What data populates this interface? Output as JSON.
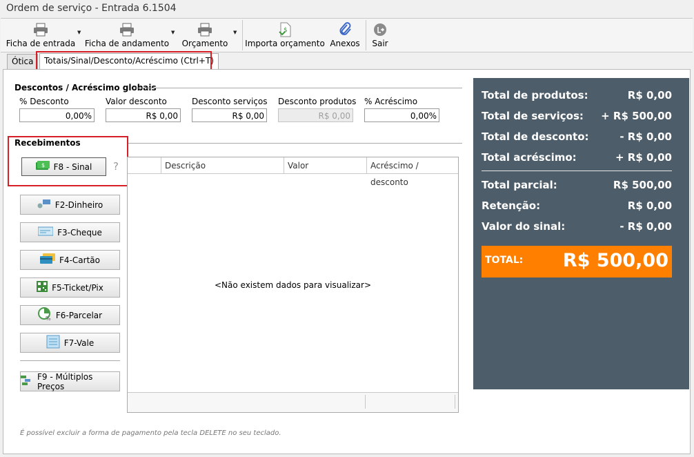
{
  "window": {
    "title": "Ordem de serviço - Entrada  6.1504"
  },
  "toolbar": {
    "ficha_entrada": "Ficha de entrada",
    "ficha_andamento": "Ficha de andamento",
    "orcamento": "Orçamento",
    "importa_orcamento": "Importa orçamento",
    "anexos": "Anexos",
    "sair": "Sair"
  },
  "tabs": {
    "otica": "Ótica",
    "totais": "Totais/Sinal/Desconto/Acréscimo (Ctrl+T)"
  },
  "descontos": {
    "title": "Descontos / Acréscimo globais",
    "pct_desconto_label": "% Desconto",
    "pct_desconto_value": "0,00%",
    "valor_desconto_label": "Valor desconto",
    "valor_desconto_value": "R$ 0,00",
    "desconto_servicos_label": "Desconto serviços",
    "desconto_servicos_value": "R$ 0,00",
    "desconto_produtos_label": "Desconto produtos",
    "desconto_produtos_value": "R$ 0,00",
    "pct_acrescimo_label": "% Acréscimo",
    "pct_acrescimo_value": "0,00%"
  },
  "recebimentos": {
    "title": "Recebimentos",
    "sinal": "F8 - Sinal",
    "help": "?",
    "dinheiro": "F2-Dinheiro",
    "cheque": "F3-Cheque",
    "cartao": "F4-Cartão",
    "ticket": "F5-Ticket/Pix",
    "parcelar": "F6-Parcelar",
    "vale": "F7-Vale",
    "multiplos": "F9 - Múltiplos Preços"
  },
  "grid": {
    "columns": [
      "Descrição",
      "Valor",
      "Acréscimo / desconto"
    ],
    "empty": "<Não existem dados para visualizar>"
  },
  "footer_hint": "É possível excluir a forma de pagamento pela tecla DELETE no seu teclado.",
  "summary": {
    "produtos_label": "Total de produtos:",
    "produtos_value": "R$ 0,00",
    "servicos_label": "Total de serviços:",
    "servicos_value": "+ R$ 500,00",
    "desconto_label": "Total de desconto:",
    "desconto_value": "- R$ 0,00",
    "acrescimo_label": "Total acréscimo:",
    "acrescimo_value": "+ R$ 0,00",
    "parcial_label": "Total parcial:",
    "parcial_value": "R$ 500,00",
    "retencao_label": "Retenção:",
    "retencao_value": "R$ 0,00",
    "sinal_label": "Valor do sinal:",
    "sinal_value": "- R$ 0,00",
    "total_label": "TOTAL:",
    "total_value": "R$ 500,00"
  },
  "colors": {
    "summary_bg": "#4d5d69",
    "total_bg": "#ff7f00",
    "highlight_border": "#d51e26"
  }
}
